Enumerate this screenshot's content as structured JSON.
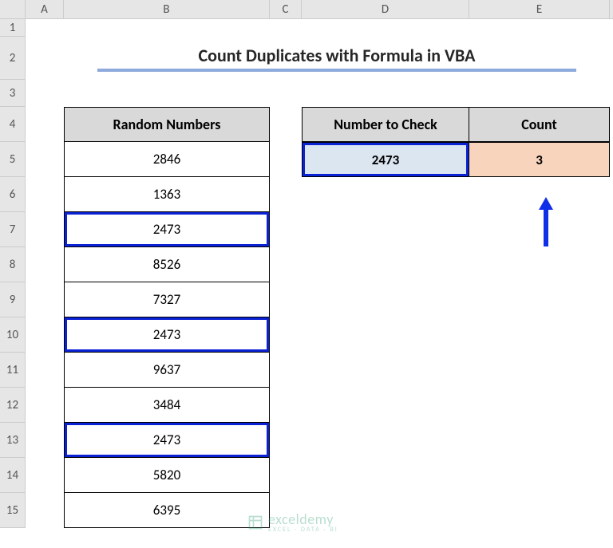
{
  "columns": [
    "A",
    "B",
    "C",
    "D",
    "E"
  ],
  "rows": [
    "1",
    "2",
    "3",
    "4",
    "5",
    "6",
    "7",
    "8",
    "9",
    "10",
    "11",
    "12",
    "13",
    "14",
    "15"
  ],
  "title": "Count Duplicates with Formula in VBA",
  "tableB": {
    "header": "Random Numbers",
    "values": [
      "2846",
      "1363",
      "2473",
      "8526",
      "7327",
      "2473",
      "9637",
      "3484",
      "2473",
      "5820",
      "6395"
    ],
    "highlight": [
      false,
      false,
      true,
      false,
      false,
      true,
      false,
      false,
      true,
      false,
      false
    ]
  },
  "check": {
    "headerD": "Number to Check",
    "headerE": "Count",
    "value": "2473",
    "result": "3"
  },
  "watermark": {
    "main": "exceldemy",
    "sub": "EXCEL · DATA · BI"
  },
  "chart_data": {
    "type": "table",
    "title": "Count Duplicates with Formula in VBA",
    "categories": [
      "Random Numbers"
    ],
    "values": [
      2846,
      1363,
      2473,
      8526,
      7327,
      2473,
      9637,
      3484,
      2473,
      5820,
      6395
    ],
    "lookup": {
      "number_to_check": 2473,
      "count": 3
    }
  }
}
